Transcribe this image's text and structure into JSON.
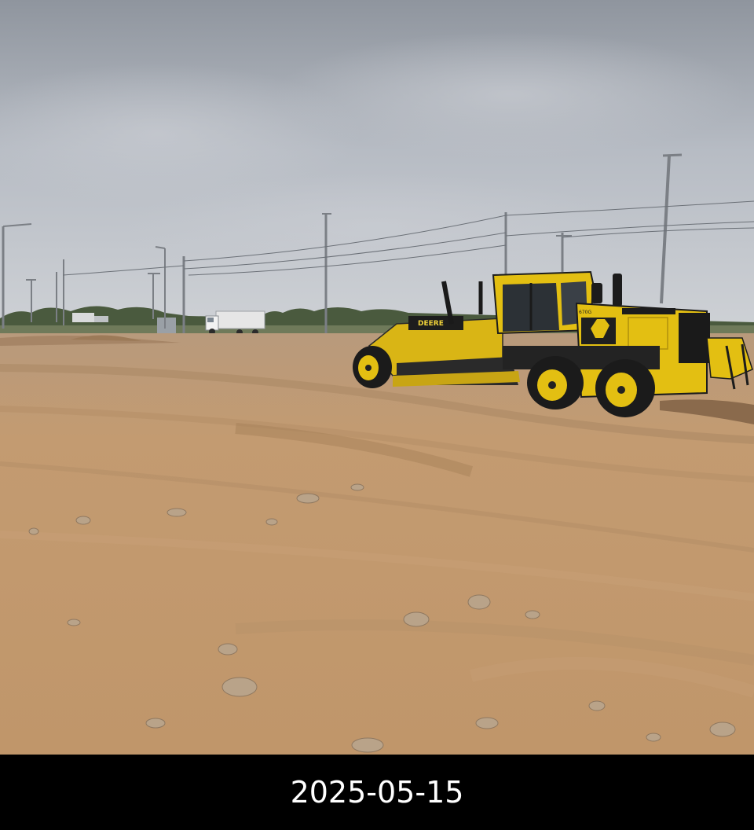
{
  "caption": {
    "date": "2025-05-15"
  },
  "scene": {
    "subject": "motor-grader",
    "machine_brand": "DEERE",
    "machine_model": "670G",
    "colors": {
      "sky": "#b8bdc6",
      "soil": "#c49a6c",
      "machine_yellow": "#e3bf12",
      "machine_dark": "#1f1f1f",
      "caption_background": "#000000",
      "caption_text": "#ffffff"
    }
  }
}
